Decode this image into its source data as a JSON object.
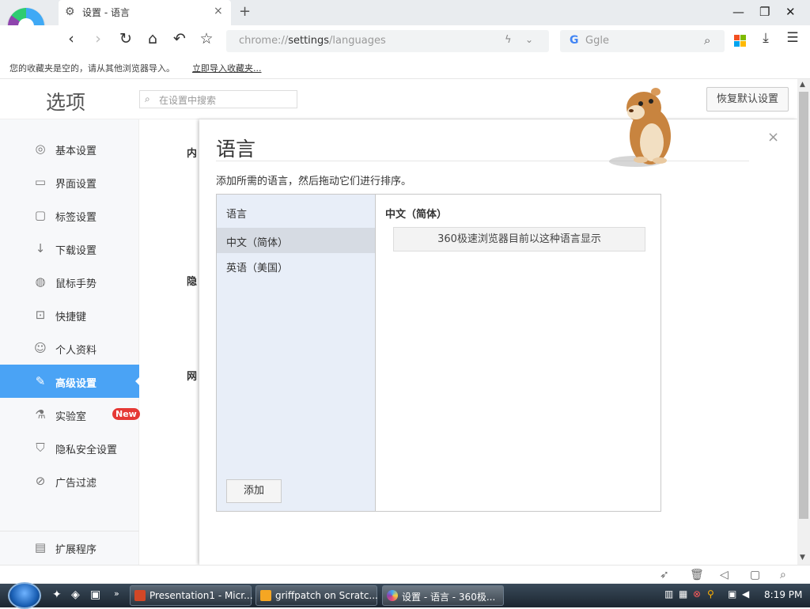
{
  "browser": {
    "tab_title": "设置 - 语言",
    "close_tab": "×",
    "new_tab": "+",
    "window_min": "—",
    "window_max": "❐",
    "window_close": "✕",
    "url_prefix": "chrome://",
    "url_main": "settings",
    "url_suffix": "/languages",
    "search_engine_letter": "G",
    "search_text": "Ggle"
  },
  "bookmarks": {
    "empty_text": "您的收藏夹是空的，请从其他浏览器导入。",
    "import_link": "立即导入收藏夹..."
  },
  "settings": {
    "title": "选项",
    "search_placeholder": "在设置中搜索",
    "restore_button": "恢复默认设置",
    "sidebar": [
      {
        "label": "基本设置",
        "icon": "circle-icon"
      },
      {
        "label": "界面设置",
        "icon": "window-icon"
      },
      {
        "label": "标签设置",
        "icon": "tab-icon"
      },
      {
        "label": "下载设置",
        "icon": "download-icon"
      },
      {
        "label": "鼠标手势",
        "icon": "mouse-icon"
      },
      {
        "label": "快捷键",
        "icon": "shortcut-icon"
      },
      {
        "label": "个人资料",
        "icon": "person-icon"
      },
      {
        "label": "高级设置",
        "icon": "wrench-icon"
      },
      {
        "label": "实验室",
        "icon": "flask-icon",
        "badge": "New"
      },
      {
        "label": "隐私安全设置",
        "icon": "shield-icon"
      },
      {
        "label": "广告过滤",
        "icon": "block-icon"
      },
      {
        "label": "扩展程序",
        "icon": "extension-icon"
      }
    ],
    "background_labels": [
      "内",
      "隐",
      "网"
    ]
  },
  "dialog": {
    "title": "语言",
    "close": "×",
    "description": "添加所需的语言，然后拖动它们进行排序。",
    "list_header": "语言",
    "languages": [
      "中文（简体）",
      "英语（美国）"
    ],
    "selected_language": "中文（简体）",
    "add_button": "添加",
    "display_button": "360极速浏览器目前以这种语言显示"
  },
  "taskbar": {
    "items": [
      "Presentation1 - Micr...",
      "griffpatch on Scratc...",
      "设置 - 语言 - 360极..."
    ],
    "clock": "8:19 PM"
  },
  "colors": {
    "accent": "#4aa3f5",
    "badge": "#e53935"
  }
}
